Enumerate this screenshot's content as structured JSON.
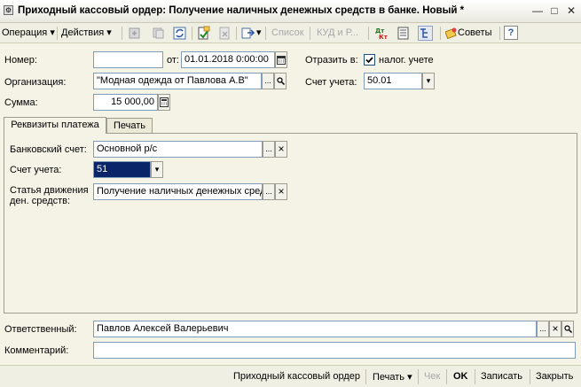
{
  "window": {
    "title": "Приходный кассовый ордер: Получение наличных денежных средств в банке. Новый *",
    "minimize": "—",
    "maximize": "□",
    "close": "✕"
  },
  "toolbar": {
    "operation": "Операция",
    "actions": "Действия",
    "list": "Список",
    "kudir": "КУД и Р...",
    "dt_kt_top": "Дт",
    "dt_kt_bottom": "Кт",
    "tips": "Советы",
    "help": "?"
  },
  "form": {
    "number_label": "Номер:",
    "number_value": "",
    "date_label": "от:",
    "date_value": "01.01.2018  0:00:00",
    "reflect_label": "Отразить в:",
    "tax_label": "налог. учете",
    "tax_checked": true,
    "org_label": "Организация:",
    "org_value": "\"Модная одежда от Павлова А.В\"",
    "account_label": "Счет учета:",
    "account_value": "50.01",
    "sum_label": "Сумма:",
    "sum_value": "15 000,00"
  },
  "tabs": [
    {
      "label": "Реквизиты платежа",
      "active": true
    },
    {
      "label": "Печать",
      "active": false
    }
  ],
  "payment": {
    "bank_label": "Банковский счет:",
    "bank_value": "Основной р/с",
    "account_label": "Счет учета:",
    "account_value": "51",
    "flow_label_1": "Статья движения",
    "flow_label_2": "ден. средств:",
    "flow_value": "Получение наличных денежных сред"
  },
  "footer": {
    "responsible_label": "Ответственный:",
    "responsible_value": "Павлов Алексей Валерьевич",
    "comment_label": "Комментарий:",
    "comment_value": ""
  },
  "statusbar": {
    "doc": "Приходный кассовый ордер",
    "print": "Печать",
    "check": "Чек",
    "ok": "OK",
    "save": "Записать",
    "close": "Закрыть"
  },
  "icons": {
    "select": "...",
    "clear": "×",
    "open": "search-icon",
    "dropdown": "▾",
    "calendar": "calendar-icon",
    "calculator": "calculator-icon"
  }
}
